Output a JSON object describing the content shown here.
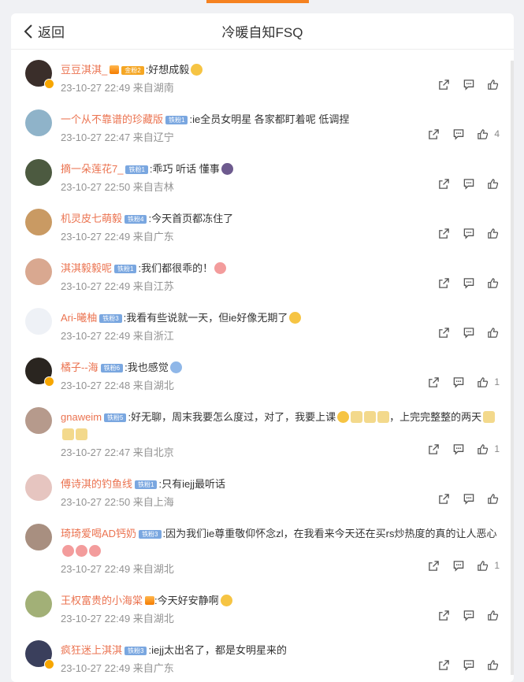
{
  "header": {
    "back_label": "返回",
    "title": "冷暖自知FSQ"
  },
  "comments": [
    {
      "name": "豆豆淇淇_",
      "badge": "金粉2",
      "badge_color": "gold",
      "crown": true,
      "text": ":好想成毅",
      "emojis": [
        "yellow"
      ],
      "time": "23-10-27 22:49 来自湖南",
      "likes": "",
      "avatar_color": "#3a2e2a",
      "verified": true
    },
    {
      "name": "一个从不靠谱的珍藏版",
      "badge": "铁粉1",
      "badge_color": "blue",
      "text": ":ie全员女明星 各家都盯着呢 低调捏",
      "emojis": [],
      "time": "23-10-27 22:47 来自辽宁",
      "likes": "4",
      "avatar_color": "#8fb3c9"
    },
    {
      "name": "摘一朵莲花7_",
      "badge": "铁粉1",
      "badge_color": "blue",
      "text": ":乖巧 听话 懂事",
      "emojis": [
        "dark"
      ],
      "time": "23-10-27 22:50 来自吉林",
      "likes": "",
      "avatar_color": "#4c5a40"
    },
    {
      "name": "机灵皮七萌毅",
      "badge": "铁粉4",
      "badge_color": "blue",
      "text": ":今天首页都冻住了",
      "emojis": [],
      "time": "23-10-27 22:49 来自广东",
      "likes": "",
      "avatar_color": "#c99a63"
    },
    {
      "name": "淇淇毅毅呢",
      "badge": "铁粉1",
      "badge_color": "blue",
      "text": ":我们都很乖的！",
      "emojis": [
        "pink"
      ],
      "time": "23-10-27 22:49 来自江苏",
      "likes": "",
      "avatar_color": "#d9a890"
    },
    {
      "name": "Ari-曦柚",
      "badge": "铁粉3",
      "badge_color": "blue",
      "text": ":我看有些说就一天，但ie好像无期了",
      "emojis": [
        "yellow"
      ],
      "time": "23-10-27 22:49 来自浙江",
      "likes": "",
      "avatar_color": "#eef1f6"
    },
    {
      "name": "橘子--海",
      "badge": "铁粉6",
      "badge_color": "blue",
      "text": ":我也感觉",
      "emojis": [
        "blue"
      ],
      "time": "23-10-27 22:48 来自湖北",
      "likes": "1",
      "avatar_color": "#2a2520",
      "verified": true
    },
    {
      "name": "gnaweim",
      "badge": "铁粉5",
      "badge_color": "blue",
      "text": ":好无聊，周末我要怎么度过，对了，我要上课",
      "emojis": [
        "yellow",
        "cat",
        "cat",
        "cat"
      ],
      "text2": "，上完完整整的两天",
      "emojis2": [
        "cat",
        "cat",
        "cat"
      ],
      "time": "23-10-27 22:47 来自北京",
      "likes": "1",
      "avatar_color": "#b69a8c",
      "tall": true
    },
    {
      "name": "傅诗淇的钓鱼线",
      "badge": "铁粉1",
      "badge_color": "blue",
      "text": ":只有iejj最听话",
      "emojis": [],
      "time": "23-10-27 22:50 来自上海",
      "likes": "",
      "avatar_color": "#e6c5c0"
    },
    {
      "name": "琦琦爱喝AD钙奶",
      "badge": "铁粉3",
      "badge_color": "blue",
      "text": ":因为我们ie尊重敬仰怀念zl，在我看来今天还在买rs炒热度的真的让人恶心",
      "emojis": [
        "pink",
        "pink",
        "pink"
      ],
      "time": "23-10-27 22:49 来自湖北",
      "likes": "1",
      "avatar_color": "#a88f80",
      "tall": true
    },
    {
      "name": "王权富贵的小海棠",
      "badge": "",
      "badge_color": "",
      "text": ":今天好安静啊",
      "emojis": [
        "yellow"
      ],
      "time": "23-10-27 22:49 来自湖北",
      "likes": "",
      "avatar_color": "#a2b077"
    },
    {
      "name": "疯狂迷上淇淇",
      "badge": "铁粉3",
      "badge_color": "blue",
      "text": ":iejj太出名了，都是女明星来的",
      "emojis": [],
      "time": "23-10-27 22:49 来自广东",
      "likes": "",
      "avatar_color": "#3a3f5c",
      "verified": true
    }
  ],
  "icons": {
    "back": "chevron-left-icon",
    "share": "share-icon",
    "comment": "comment-icon",
    "like": "thumbs-up-icon"
  },
  "colors": {
    "accent": "#f58220",
    "name": "#eb7350",
    "meta": "#939393"
  }
}
